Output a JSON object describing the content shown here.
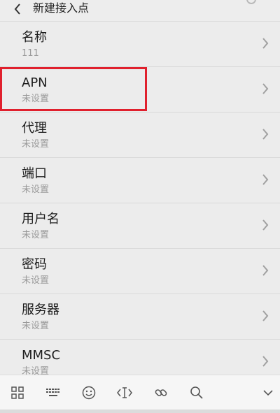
{
  "header": {
    "title": "新建接入点"
  },
  "rows": [
    {
      "label": "名称",
      "value": "111"
    },
    {
      "label": "APN",
      "value": "未设置"
    },
    {
      "label": "代理",
      "value": "未设置"
    },
    {
      "label": "端口",
      "value": "未设置"
    },
    {
      "label": "用户名",
      "value": "未设置"
    },
    {
      "label": "密码",
      "value": "未设置"
    },
    {
      "label": "服务器",
      "value": "未设置"
    },
    {
      "label": "MMSC",
      "value": "未设置"
    }
  ],
  "toolbar": {
    "icons": [
      "grid-icon",
      "keyboard-icon",
      "emoji-icon",
      "cursor-icon",
      "link-icon",
      "search-icon",
      "collapse-icon"
    ]
  },
  "colors": {
    "highlight": "#e0202d",
    "background": "#ececec"
  }
}
